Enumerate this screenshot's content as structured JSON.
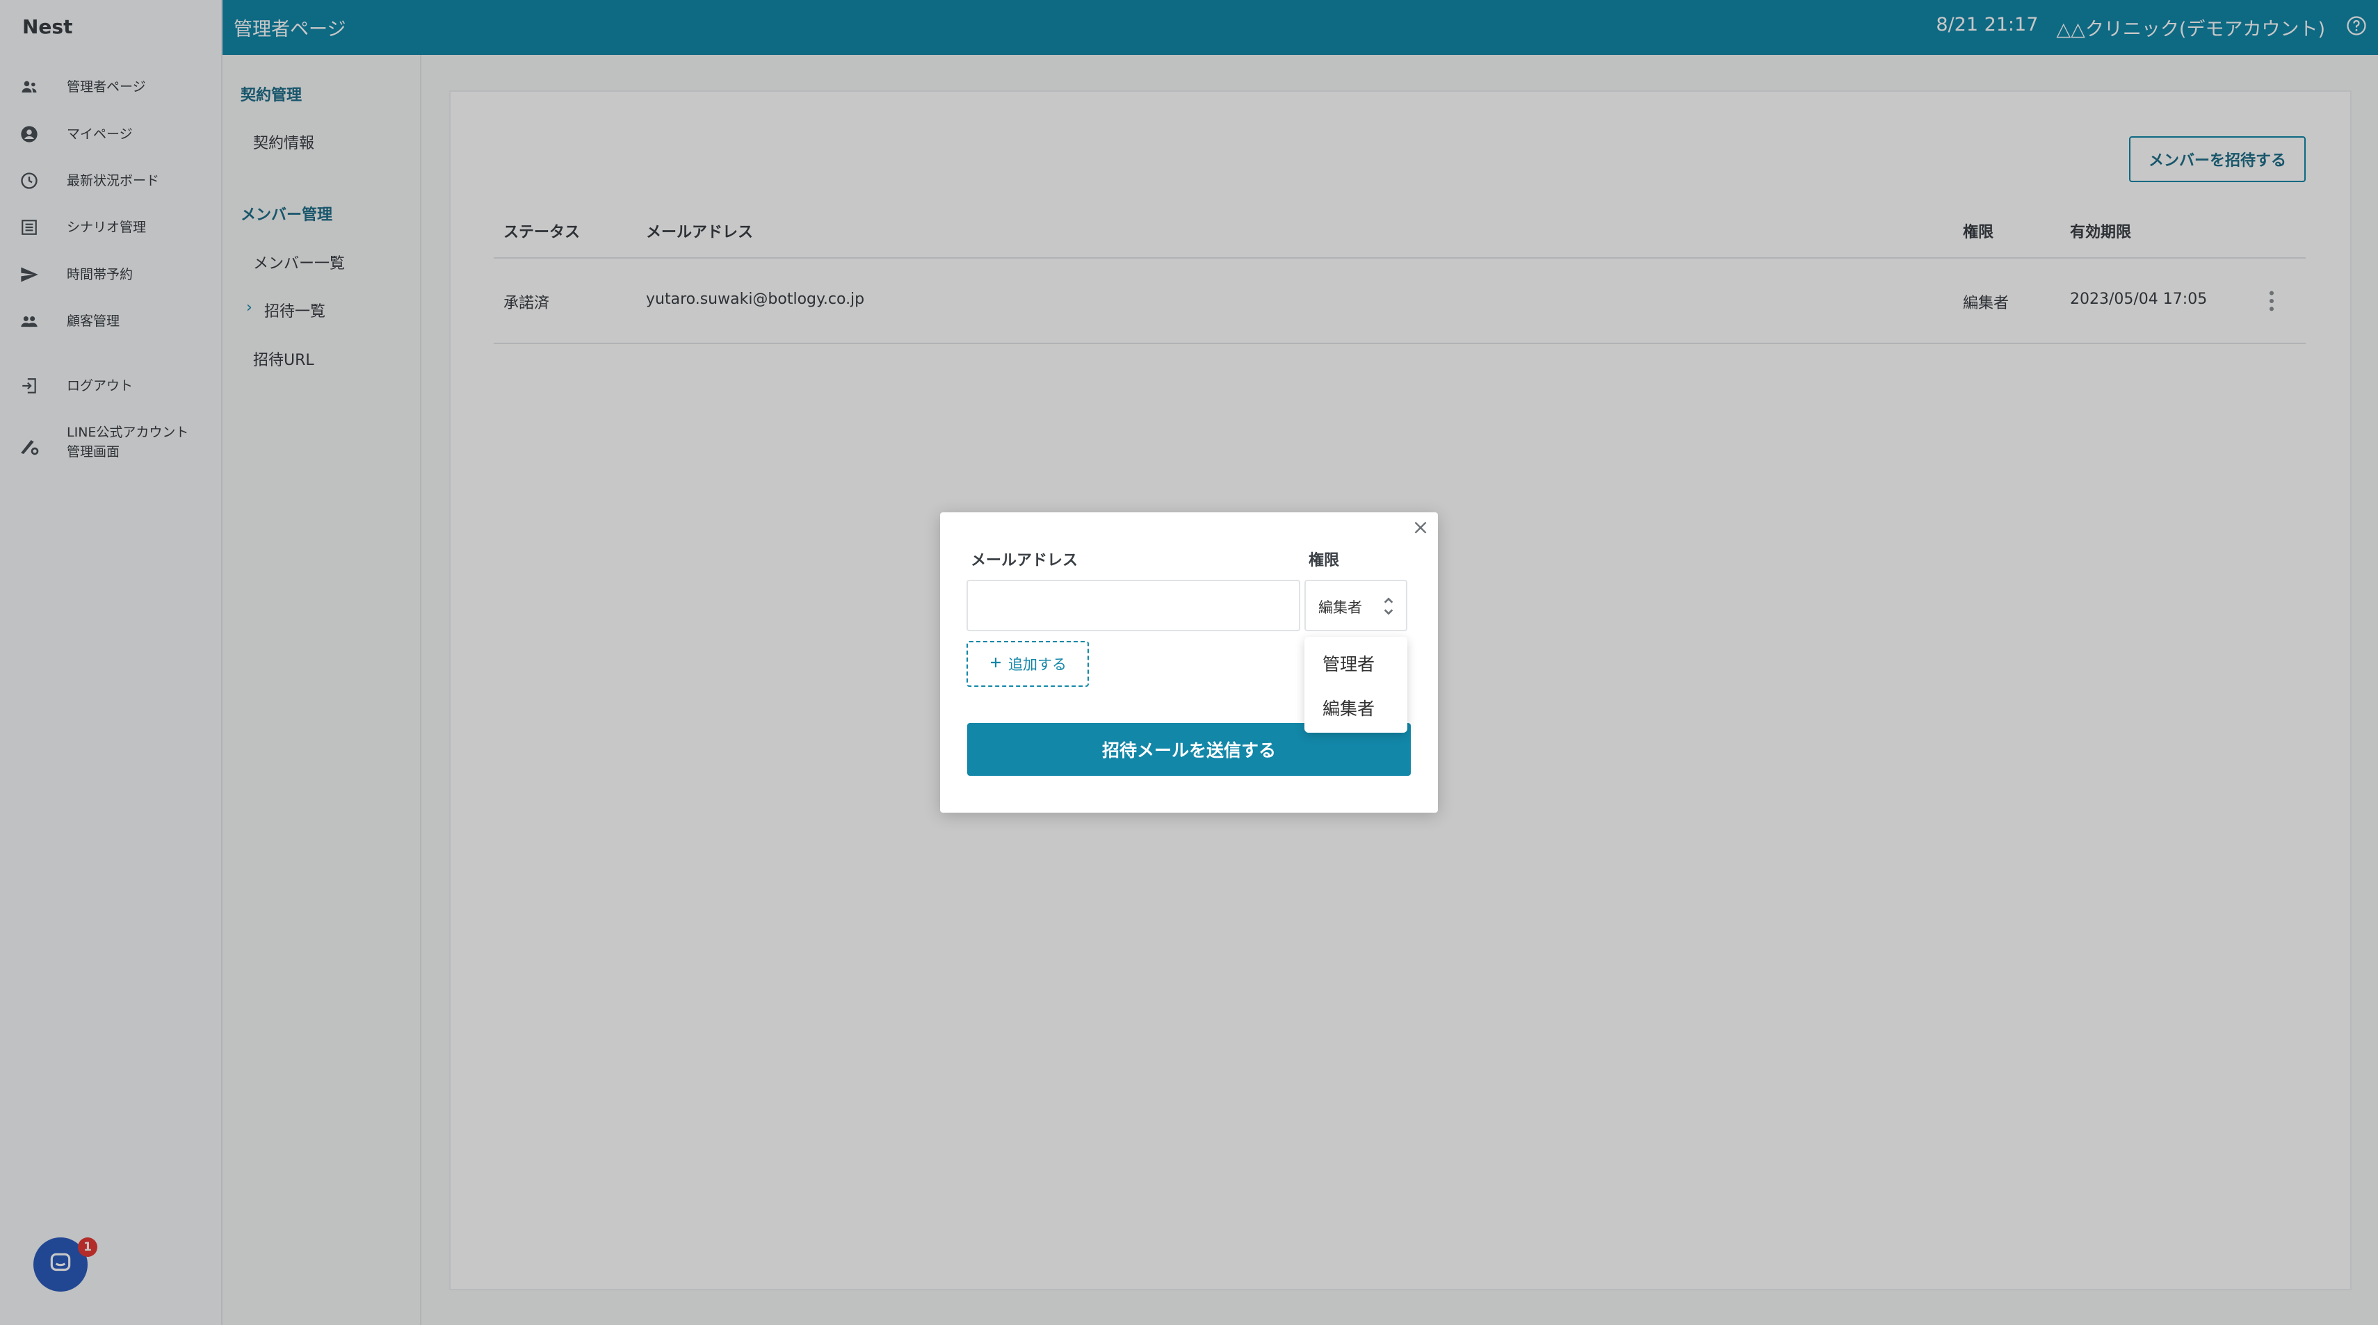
{
  "app": {
    "brand": "Nest"
  },
  "sidebar": {
    "items": [
      {
        "label": "管理者ページ",
        "icon": "admin-users-icon"
      },
      {
        "label": "マイページ",
        "icon": "account-circle-icon"
      },
      {
        "label": "最新状況ボード",
        "icon": "clock-icon"
      },
      {
        "label": "シナリオ管理",
        "icon": "list-icon"
      },
      {
        "label": "時間帯予約",
        "icon": "send-icon"
      },
      {
        "label": "顧客管理",
        "icon": "people-icon"
      },
      {
        "label": "ログアウト",
        "icon": "logout-icon"
      },
      {
        "label_line1": "LINE公式アカウント",
        "label_line2": "管理画面",
        "icon": "line-settings-icon"
      }
    ]
  },
  "topbar": {
    "title": "管理者ページ",
    "datetime": "8/21 21:17",
    "account": "△△クリニック(デモアカウント)"
  },
  "subnav": {
    "section1": "契約管理",
    "contract_info": "契約情報",
    "section2": "メンバー管理",
    "member_list": "メンバー一覧",
    "invite_list": "招待一覧",
    "invite_url": "招待URL"
  },
  "main": {
    "invite_button": "メンバーを招待する",
    "columns": [
      "ステータス",
      "メールアドレス",
      "権限",
      "有効期限"
    ],
    "rows": [
      {
        "status": "承諾済",
        "email": "yutaro.suwaki@botlogy.co.jp",
        "role": "編集者",
        "expires": "2023/05/04 17:05"
      }
    ]
  },
  "modal": {
    "email_label": "メールアドレス",
    "role_label": "権限",
    "email_value": "",
    "role_selected": "編集者",
    "add_label": "追加する",
    "send_label": "招待メールを送信する",
    "options": [
      "管理者",
      "編集者"
    ]
  },
  "chat": {
    "badge": "1"
  },
  "colors": {
    "accent": "#1387a8",
    "badge": "#e53935"
  }
}
